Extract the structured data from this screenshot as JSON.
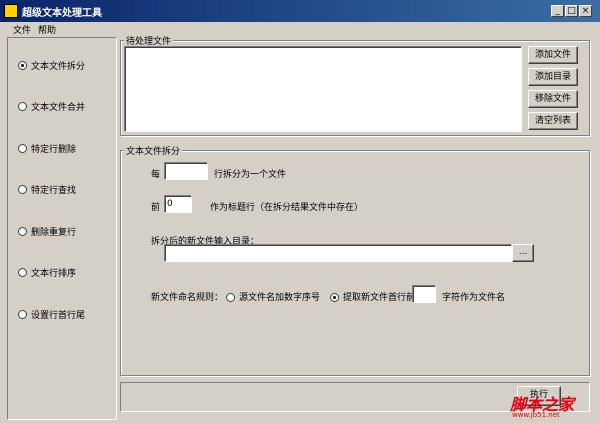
{
  "window": {
    "title": "超级文本处理工具",
    "controls": {
      "minimize": "_",
      "maximize": "□",
      "close": "×"
    }
  },
  "menu": [
    "文件",
    "帮助"
  ],
  "nav": {
    "items": [
      "文本文件拆分",
      "文本文件合并",
      "特定行删除",
      "特定行查找",
      "删除重复行",
      "文本行排序",
      "设置行首行尾"
    ],
    "selected_index": 0
  },
  "files_group": {
    "title": "待处理文件",
    "buttons": [
      "添加文件",
      "添加目录",
      "移除文件",
      "清空列表"
    ]
  },
  "split_group": {
    "title": "文本文件拆分",
    "per_label": "每",
    "per_value": "",
    "per_suffix": "行拆分为一个文件",
    "head_label": "前",
    "head_value": "0",
    "head_suffix": "作为标题行（在拆分结果文件中存在）",
    "dir_label": "拆分后的新文件输入目录：",
    "dir_value": "",
    "browse_label": "...",
    "naming_label": "新文件命名规则：",
    "naming_option1": "源文件名加数字序号",
    "naming_option2": "提取新文件首行前",
    "naming_selected": 1,
    "naming_chars_value": "",
    "naming_chars_suffix": "字符作为文件名"
  },
  "bottom": {
    "action_label": "执行"
  },
  "watermark": {
    "logo": "脚本之家",
    "url": "www.jb51.net"
  }
}
